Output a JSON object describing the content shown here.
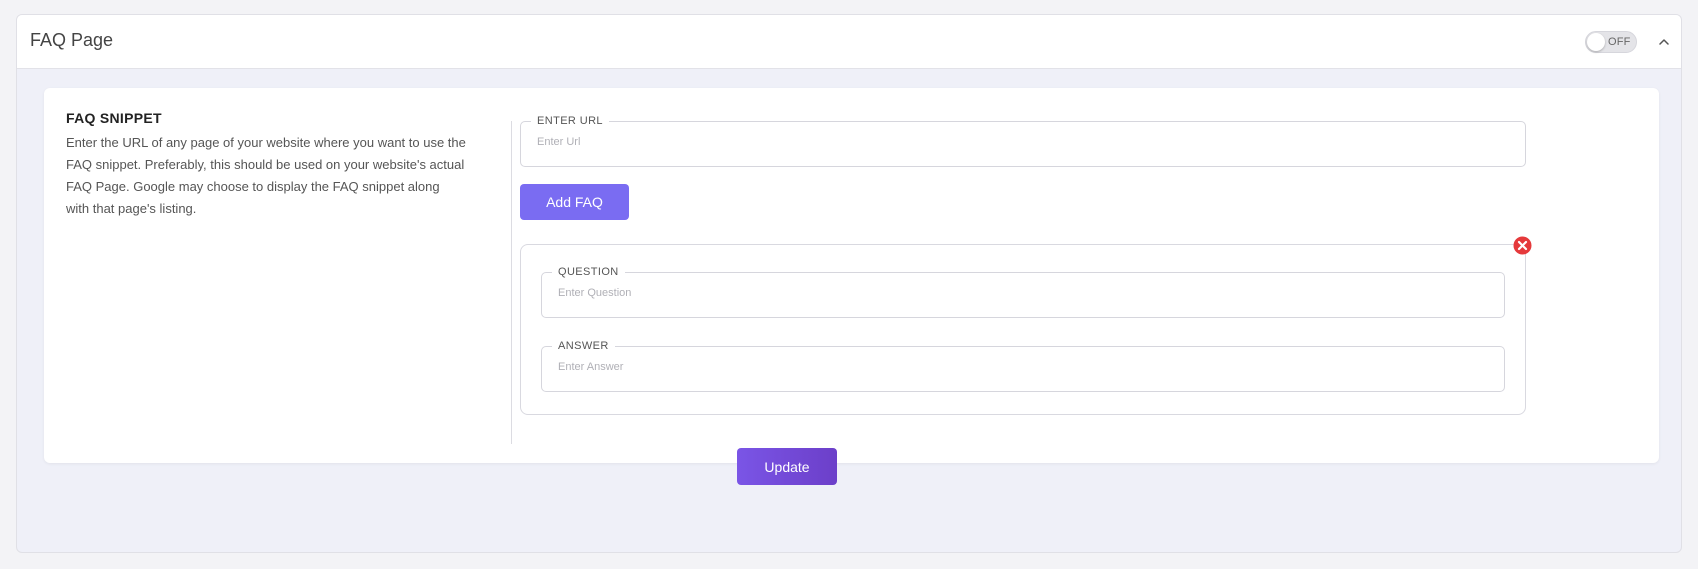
{
  "header": {
    "title": "FAQ Page",
    "toggle_label": "OFF",
    "toggle_state": "off"
  },
  "snippet": {
    "title": "FAQ SNIPPET",
    "description": "Enter the URL of any page of your website where you want to use the FAQ snippet. Preferably, this should be used on your website's actual FAQ Page. Google may choose to display the FAQ snippet along with that page's listing."
  },
  "url_field": {
    "label": "ENTER URL",
    "placeholder": "Enter Url",
    "value": ""
  },
  "add_button": {
    "label": "Add FAQ"
  },
  "faq_item": {
    "question_label": "QUESTION",
    "question_placeholder": "Enter Question",
    "answer_label": "ANSWER",
    "answer_placeholder": "Enter Answer"
  },
  "update_button": {
    "label": "Update"
  },
  "colors": {
    "accent": "#7a6cf2",
    "update": "#6c3fc9",
    "remove": "#e5393b"
  },
  "icons": {
    "collapse": "chevron-up-icon",
    "remove": "remove-circle-icon"
  }
}
